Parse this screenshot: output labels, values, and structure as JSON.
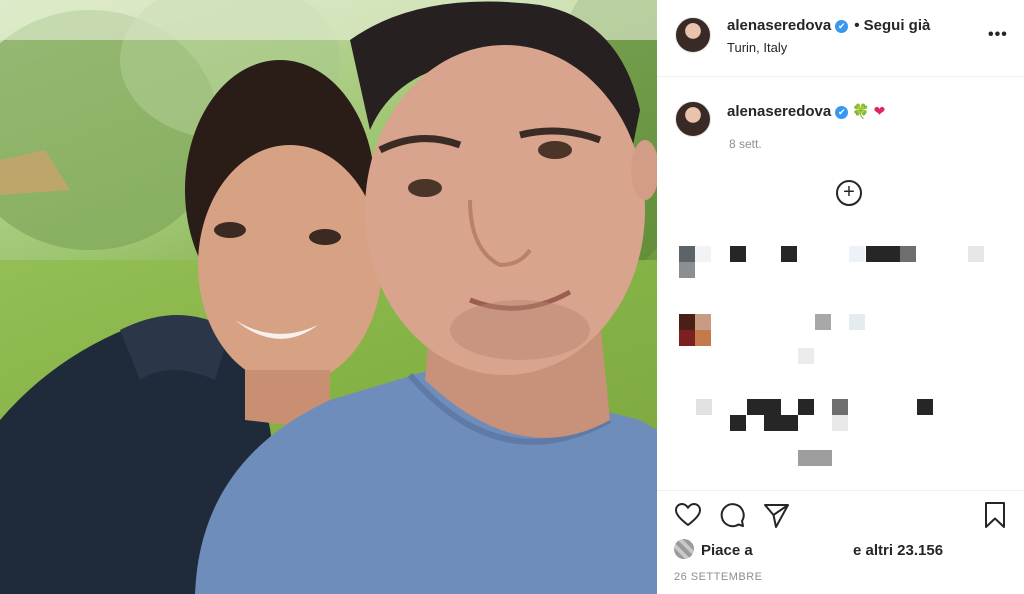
{
  "post": {
    "username": "alenaseredova",
    "verified_mark": "✔",
    "follow_label": "• Segui già",
    "location": "Turin, Italy",
    "more_icon": "•••"
  },
  "caption": {
    "username": "alenaseredova",
    "verified_mark": "✔",
    "emoji_clover": "🍀",
    "emoji_heart": "❤",
    "date": "8 sett."
  },
  "comments": {
    "add_icon": "+"
  },
  "actions": {
    "icons": [
      "heart-icon",
      "comment-icon",
      "share-icon",
      "bookmark-icon"
    ]
  },
  "likes": {
    "prefix": "Piace a",
    "count_text": "e altri 23.156"
  },
  "post_date": "26 SETTEMBRE",
  "colors": {
    "verified": "#3897f0",
    "secondary_text": "#8e8e8e",
    "primary_text": "#262626"
  }
}
